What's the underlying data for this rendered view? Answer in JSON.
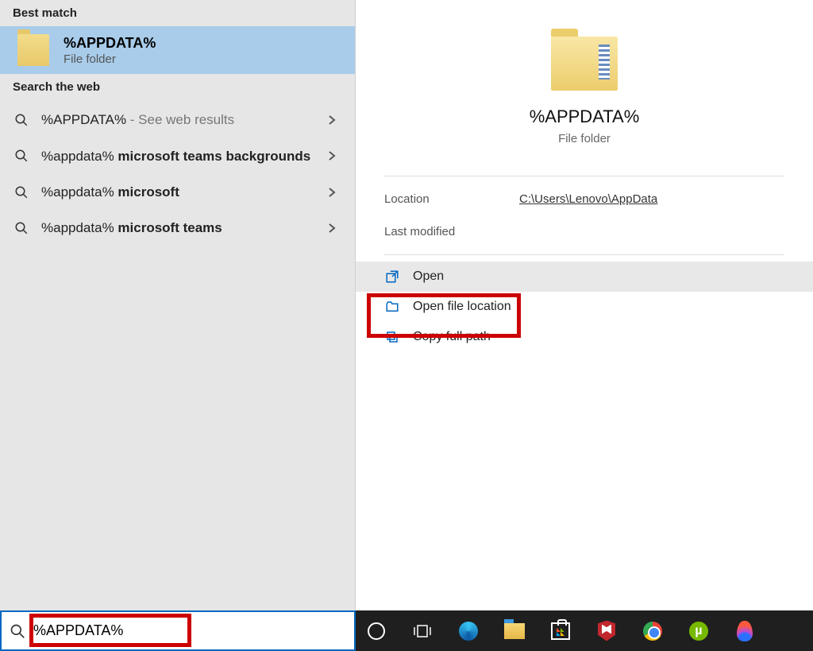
{
  "left": {
    "best_match_header": "Best match",
    "selected": {
      "title": "%APPDATA%",
      "subtitle": "File folder"
    },
    "web_header": "Search the web",
    "web_items": [
      {
        "prefix": "%APPDATA%",
        "bold": "",
        "suffix": " - See web results"
      },
      {
        "prefix": "%appdata% ",
        "bold": "microsoft teams backgrounds",
        "suffix": ""
      },
      {
        "prefix": "%appdata% ",
        "bold": "microsoft",
        "suffix": ""
      },
      {
        "prefix": "%appdata% ",
        "bold": "microsoft teams",
        "suffix": ""
      }
    ]
  },
  "right": {
    "title": "%APPDATA%",
    "subtitle": "File folder",
    "meta": {
      "location_label": "Location",
      "location_value": "C:\\Users\\Lenovo\\AppData",
      "last_modified_label": "Last modified"
    },
    "actions": {
      "open": "Open",
      "open_location": "Open file location",
      "copy_path": "Copy full path"
    }
  },
  "taskbar": {
    "search_value": "%APPDATA%",
    "icons": {
      "cortana": "cortana",
      "taskview": "task-view",
      "edge": "edge",
      "explorer": "file-explorer",
      "store": "microsoft-store",
      "mcafee": "mcafee",
      "chrome": "chrome",
      "utorrent": "µ",
      "paint3d": "paint3d"
    }
  }
}
